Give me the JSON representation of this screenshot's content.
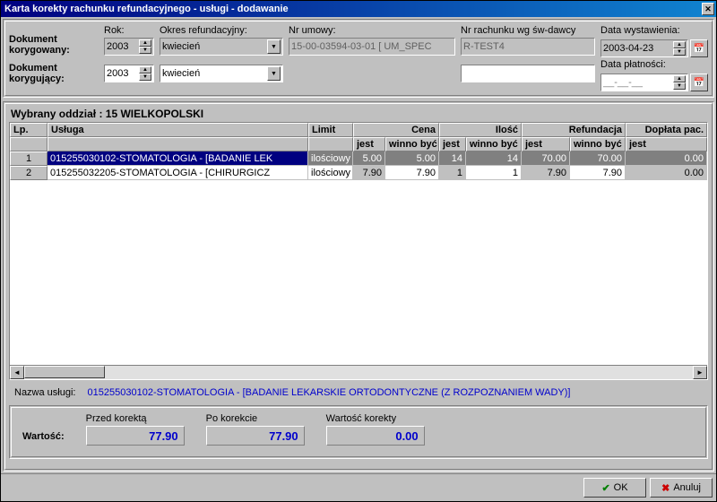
{
  "title": "Karta korekty rachunku refundacyjnego - usługi - dodawanie",
  "labels": {
    "dok_kor1": "Dokument korygowany:",
    "dok_kor2": "Dokument korygujący:",
    "rok": "Rok:",
    "okres": "Okres refundacyjny:",
    "umowa": "Nr umowy:",
    "rach": "Nr rachunku wg św-dawcy",
    "data_wyst": "Data wystawienia:",
    "data_plat": "Data płatności:",
    "section": "Wybrany oddział : 15 WIELKOPOLSKI",
    "nazwa_uslugi_lbl": "Nazwa usługi:",
    "wartosc": "Wartość:",
    "przed": "Przed korektą",
    "po": "Po korekcie",
    "war_kor": "Wartość korekty",
    "ok": "OK",
    "anuluj": "Anuluj"
  },
  "corrected": {
    "rok": "2003",
    "okres": "kwiecień",
    "umowa": "15-00-03594-03-01  [ UM_SPEC",
    "rach": "R-TEST4",
    "data_wyst": "2003-04-23",
    "data_plat": "__-__-__"
  },
  "correcting": {
    "rok": "2003",
    "okres": "kwiecień",
    "rach": ""
  },
  "grid": {
    "head1": {
      "lp": "Lp.",
      "usluga": "Usługa",
      "limit": "Limit",
      "cena": "Cena",
      "ilosc": "Ilość",
      "ref": "Refundacja",
      "dop": "Dopłata pac."
    },
    "head2": {
      "jest": "jest",
      "winno": "winno być"
    },
    "rows": [
      {
        "lp": "1",
        "usluga": "015255030102-STOMATOLOGIA - [BADANIE LEK",
        "limit": "ilościowy",
        "cena_j": "5.00",
        "cena_w": "5.00",
        "il_j": "14",
        "il_w": "14",
        "ref_j": "70.00",
        "ref_w": "70.00",
        "dop_j": "0.00"
      },
      {
        "lp": "2",
        "usluga": "015255032205-STOMATOLOGIA - [CHIRURGICZ",
        "limit": "ilościowy",
        "cena_j": "7.90",
        "cena_w": "7.90",
        "il_j": "1",
        "il_w": "1",
        "ref_j": "7.90",
        "ref_w": "7.90",
        "dop_j": "0.00"
      }
    ]
  },
  "nazwa_uslugi": "015255030102-STOMATOLOGIA - [BADANIE LEKARSKIE ORTODONTYCZNE (Z ROZPOZNANIEM WADY)]",
  "totals": {
    "przed": "77.90",
    "po": "77.90",
    "kor": "0.00"
  }
}
